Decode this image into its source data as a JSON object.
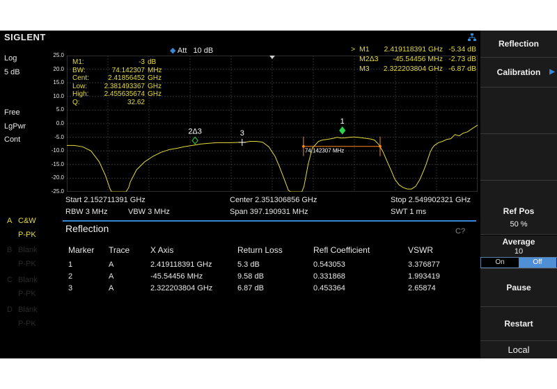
{
  "brand": {
    "logo": "SIGLENT"
  },
  "left_panel": {
    "scale_type": "Log",
    "scale_div": "5 dB",
    "detector": "Free",
    "detector_mode": "LgPwr",
    "sweep": "Cont",
    "traces": [
      {
        "id": "A",
        "type": "C&W",
        "mode": "P-PK",
        "active": true
      },
      {
        "id": "B",
        "type": "Blank",
        "mode": "P-PK",
        "active": false
      },
      {
        "id": "C",
        "type": "Blank",
        "mode": "P-PK",
        "active": false
      },
      {
        "id": "D",
        "type": "Blank",
        "mode": "P-PK",
        "active": false
      }
    ]
  },
  "header": {
    "att_label": "Att",
    "att_value": "10 dB"
  },
  "marker_readout": [
    {
      "prefix": ">",
      "name": "M1",
      "freq": "2.419118391 GHz",
      "level": "-5.34 dB"
    },
    {
      "prefix": "",
      "name": "M2Δ3",
      "freq": "-45.54456 MHz",
      "level": "-2.73 dB"
    },
    {
      "prefix": "",
      "name": "M3",
      "freq": "2.322203804 GHz",
      "level": "-6.87 dB"
    }
  ],
  "bw_box": [
    {
      "label": "M1:",
      "value": "-3",
      "unit": "dB"
    },
    {
      "label": "BW:",
      "value": "74.142307",
      "unit": "MHz"
    },
    {
      "label": "Cent:",
      "value": "2.41856452",
      "unit": "GHz"
    },
    {
      "label": "Low:",
      "value": "2.381493367",
      "unit": "GHz"
    },
    {
      "label": "High:",
      "value": "2.455635674",
      "unit": "GHz"
    },
    {
      "label": "Q:",
      "value": "32.62",
      "unit": ""
    }
  ],
  "chart_data": {
    "type": "line",
    "y_ticks": [
      "25.0",
      "20.0",
      "15.0",
      "10.0",
      "5.0",
      "0.0",
      "-5.0",
      "-10.0",
      "-15.0",
      "-20.0",
      "-25.0"
    ],
    "ylim": [
      -25,
      25
    ],
    "xlim": [
      2.152711391,
      2.549902321
    ],
    "grid": true,
    "series": [
      {
        "x": [
          2.1527,
          2.16,
          2.168,
          2.176,
          2.184,
          2.19,
          2.1945,
          2.196,
          2.21,
          2.2125,
          2.214,
          2.22,
          2.228,
          2.236,
          2.244,
          2.252,
          2.26,
          2.266,
          2.274,
          2.282,
          2.29,
          2.298,
          2.306,
          2.312,
          2.318,
          2.324,
          2.33,
          2.336,
          2.342,
          2.348,
          2.354,
          2.358,
          2.362,
          2.365,
          2.367,
          2.369,
          2.371,
          2.38,
          2.382,
          2.384,
          2.386,
          2.39,
          2.396,
          2.4,
          2.404,
          2.41,
          2.414,
          2.418,
          2.422,
          2.426,
          2.43,
          2.434,
          2.438,
          2.442,
          2.446,
          2.45,
          2.454,
          2.458,
          2.462,
          2.466,
          2.47,
          2.474,
          2.478,
          2.482,
          2.486,
          2.49,
          2.494,
          2.498,
          2.5,
          2.504,
          2.506,
          2.508,
          2.512,
          2.516,
          2.52,
          2.524,
          2.528,
          2.532,
          2.536,
          2.54,
          2.544,
          2.5499
        ],
        "y": [
          -8.0,
          -8.0,
          -8.5,
          -10.0,
          -14.0,
          -19.0,
          -24.0,
          -25.0,
          -25.0,
          -23.5,
          -21.5,
          -17.0,
          -14.0,
          -12.0,
          -10.5,
          -9.5,
          -9.0,
          -8.5,
          -8.0,
          -7.5,
          -7.2,
          -7.0,
          -7.0,
          -7.0,
          -6.9,
          -6.9,
          -6.5,
          -6.5,
          -6.8,
          -8.5,
          -12.0,
          -15.5,
          -19.5,
          -22.5,
          -24.5,
          -25.0,
          -25.0,
          -25.0,
          -23.0,
          -19.0,
          -15.0,
          -9.0,
          -6.5,
          -6.0,
          -5.8,
          -5.4,
          -5.0,
          -5.3,
          -5.2,
          -5.0,
          -4.9,
          -5.0,
          -5.2,
          -5.4,
          -5.6,
          -6.0,
          -7.5,
          -10.0,
          -13.5,
          -17.0,
          -20.5,
          -22.5,
          -23.5,
          -24.0,
          -24.0,
          -23.0,
          -20.5,
          -17.0,
          -15.0,
          -10.5,
          -9.0,
          -8.0,
          -7.0,
          -6.5,
          -5.8,
          -5.5,
          -4.0,
          -4.5,
          -3.5,
          -3.0,
          -2.0,
          -0.5
        ]
      }
    ],
    "markers": [
      {
        "label": "1",
        "x": 2.419118391,
        "y": -2.5,
        "color": "#2ad34a",
        "shape": "diamond-filled"
      },
      {
        "label": "2Δ3",
        "x": 2.276659244,
        "y": -6.2,
        "color": "#2ad34a",
        "shape": "diamond-open"
      },
      {
        "label": "3",
        "x": 2.322203804,
        "y": -6.87,
        "color": "#ffffff",
        "shape": "cross"
      }
    ],
    "bw_line": {
      "x1": 2.381493367,
      "x2": 2.455635674,
      "y": -8.34,
      "label": "74.142307 MHz",
      "color": "#ff8a1a"
    }
  },
  "freq_info": {
    "start": "Start  2.152711391 GHz",
    "center": "Center  2.351306856 GHz",
    "stop": "Stop  2.549902321 GHz",
    "rbw": "RBW  3 MHz",
    "vbw": "VBW  3 MHz",
    "span": "Span  397.190931 MHz",
    "swt": "SWT  1 ms"
  },
  "reflection_panel": {
    "title": "Reflection",
    "status": "C?",
    "columns": [
      "Marker",
      "Trace",
      "X Axis",
      "Return Loss",
      "Refl Coefficient",
      "VSWR"
    ],
    "rows": [
      [
        "1",
        "A",
        "2.419118391 GHz",
        "5.3 dB",
        "0.543053",
        "3.376877"
      ],
      [
        "2",
        "A",
        "-45.54456 MHz",
        "9.58 dB",
        "0.331868",
        "1.993419"
      ],
      [
        "3",
        "A",
        "2.322203804 GHz",
        "6.87 dB",
        "0.453364",
        "2.65874"
      ]
    ]
  },
  "softkeys": {
    "reflection": "Reflection",
    "calibration": "Calibration",
    "ref_pos_label": "Ref Pos",
    "ref_pos_value": "50 %",
    "average_label": "Average",
    "average_value": "10",
    "average_on": "On",
    "average_off": "Off",
    "pause": "Pause",
    "restart": "Restart",
    "local": "Local"
  },
  "colors": {
    "trace": "#e6dc3a",
    "accent": "#3a86d8",
    "marker": "#2ad34a",
    "bw_line": "#ff8a1a"
  }
}
